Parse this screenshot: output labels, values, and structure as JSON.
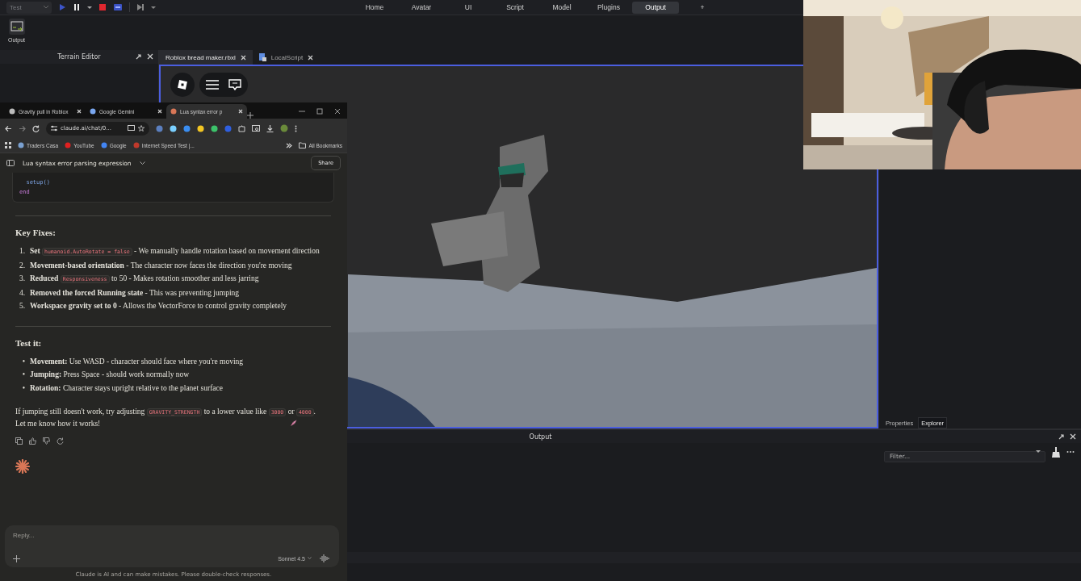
{
  "toolbar": {
    "mode_select": "Test"
  },
  "ribbon_tabs": [
    {
      "label": "Home",
      "selected": false
    },
    {
      "label": "Avatar",
      "selected": false
    },
    {
      "label": "UI",
      "selected": false
    },
    {
      "label": "Script",
      "selected": false
    },
    {
      "label": "Model",
      "selected": false
    },
    {
      "label": "Plugins",
      "selected": false
    },
    {
      "label": "Output",
      "selected": true
    }
  ],
  "add_tab": "+",
  "quick_actions": [
    {
      "label": "Output"
    }
  ],
  "left_panel": {
    "title": "Terrain Editor"
  },
  "document_tabs": [
    {
      "label": "Roblox bread maker.rbxl",
      "selected": true,
      "kind": "place"
    },
    {
      "label": "LocalScript",
      "selected": false,
      "kind": "script"
    }
  ],
  "right_panel": {
    "tabs": [
      {
        "label": "Properties",
        "selected": false
      },
      {
        "label": "Explorer",
        "selected": true
      }
    ]
  },
  "output_panel": {
    "title": "Output",
    "filter": {
      "placeholder": "Filter..."
    }
  },
  "browser": {
    "tabs": [
      {
        "title": "Gravity pull in Roblox",
        "selected": false
      },
      {
        "title": "Google Gemini",
        "selected": false
      },
      {
        "title": "Lua syntax error p",
        "selected": true
      }
    ],
    "address": "claude.ai/chat/0...",
    "bookmarks": [
      {
        "label": "Traders Casa"
      },
      {
        "label": "YouTube"
      },
      {
        "label": "Google"
      },
      {
        "label": "Internet Speed Test |..."
      }
    ],
    "all_bookmarks": "All Bookmarks"
  },
  "chat": {
    "title": "Lua syntax error parsing expression",
    "share": "Share",
    "code_lines": [
      {
        "text": "  setup()",
        "kind": "call"
      },
      {
        "text": "end",
        "kind": "keyword"
      }
    ],
    "sections": [
      {
        "heading": "Key Fixes:",
        "items": [
          {
            "marker": "1.",
            "parts": [
              {
                "kind": "bold",
                "text": "Set "
              },
              {
                "kind": "code",
                "text": "humanoid.AutoRotate = false"
              },
              {
                "kind": "text",
                "text": " - We manually handle rotation based on movement direction"
              }
            ]
          },
          {
            "marker": "2.",
            "parts": [
              {
                "kind": "bold",
                "text": "Movement-based orientation"
              },
              {
                "kind": "text",
                "text": " - The character now faces the direction you're moving"
              }
            ]
          },
          {
            "marker": "3.",
            "parts": [
              {
                "kind": "bold",
                "text": "Reduced "
              },
              {
                "kind": "code",
                "text": "Responsiveness"
              },
              {
                "kind": "text",
                "text": " to 50 - Makes rotation smoother and less jarring"
              }
            ]
          },
          {
            "marker": "4.",
            "parts": [
              {
                "kind": "bold",
                "text": "Removed the forced Running state"
              },
              {
                "kind": "text",
                "text": " - This was preventing jumping"
              }
            ]
          },
          {
            "marker": "5.",
            "parts": [
              {
                "kind": "bold",
                "text": "Workspace gravity set to 0"
              },
              {
                "kind": "text",
                "text": " - Allows the VectorForce to control gravity completely"
              }
            ]
          }
        ]
      },
      {
        "heading": "Test it:",
        "items": [
          {
            "marker": "•",
            "parts": [
              {
                "kind": "bold",
                "text": "Movement:"
              },
              {
                "kind": "text",
                "text": " Use WASD - character should face where you're moving"
              }
            ]
          },
          {
            "marker": "•",
            "parts": [
              {
                "kind": "bold",
                "text": "Jumping:"
              },
              {
                "kind": "text",
                "text": " Press Space - should work normally now"
              }
            ]
          },
          {
            "marker": "•",
            "parts": [
              {
                "kind": "bold",
                "text": "Rotation:"
              },
              {
                "kind": "text",
                "text": " Character stays upright relative to the planet surface"
              }
            ]
          }
        ]
      }
    ],
    "closing": [
      {
        "kind": "text",
        "text": "If jumping still doesn't work, try adjusting "
      },
      {
        "kind": "code",
        "text": "GRAVITY_STRENGTH"
      },
      {
        "kind": "text",
        "text": " to a lower value like "
      },
      {
        "kind": "code",
        "text": "3000"
      },
      {
        "kind": "text",
        "text": " or "
      },
      {
        "kind": "code",
        "text": "4000"
      },
      {
        "kind": "text",
        "text": ". Let me know how it works!"
      }
    ],
    "reply": {
      "placeholder": "Reply...",
      "model": "Sonnet 4.5"
    },
    "disclaimer": "Claude is AI and can make mistakes. Please double-check responses."
  }
}
